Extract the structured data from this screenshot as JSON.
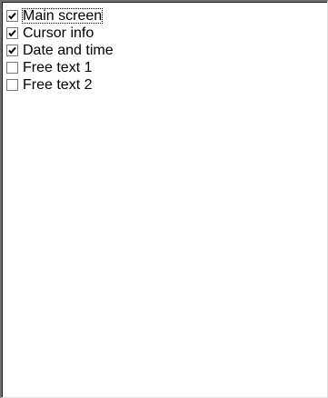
{
  "list": {
    "items": [
      {
        "label": "Main screen",
        "checked": true,
        "focused": true
      },
      {
        "label": "Cursor info",
        "checked": true,
        "focused": false
      },
      {
        "label": "Date and time",
        "checked": true,
        "focused": false
      },
      {
        "label": "Free text 1",
        "checked": false,
        "focused": false
      },
      {
        "label": "Free text 2",
        "checked": false,
        "focused": false
      }
    ]
  }
}
